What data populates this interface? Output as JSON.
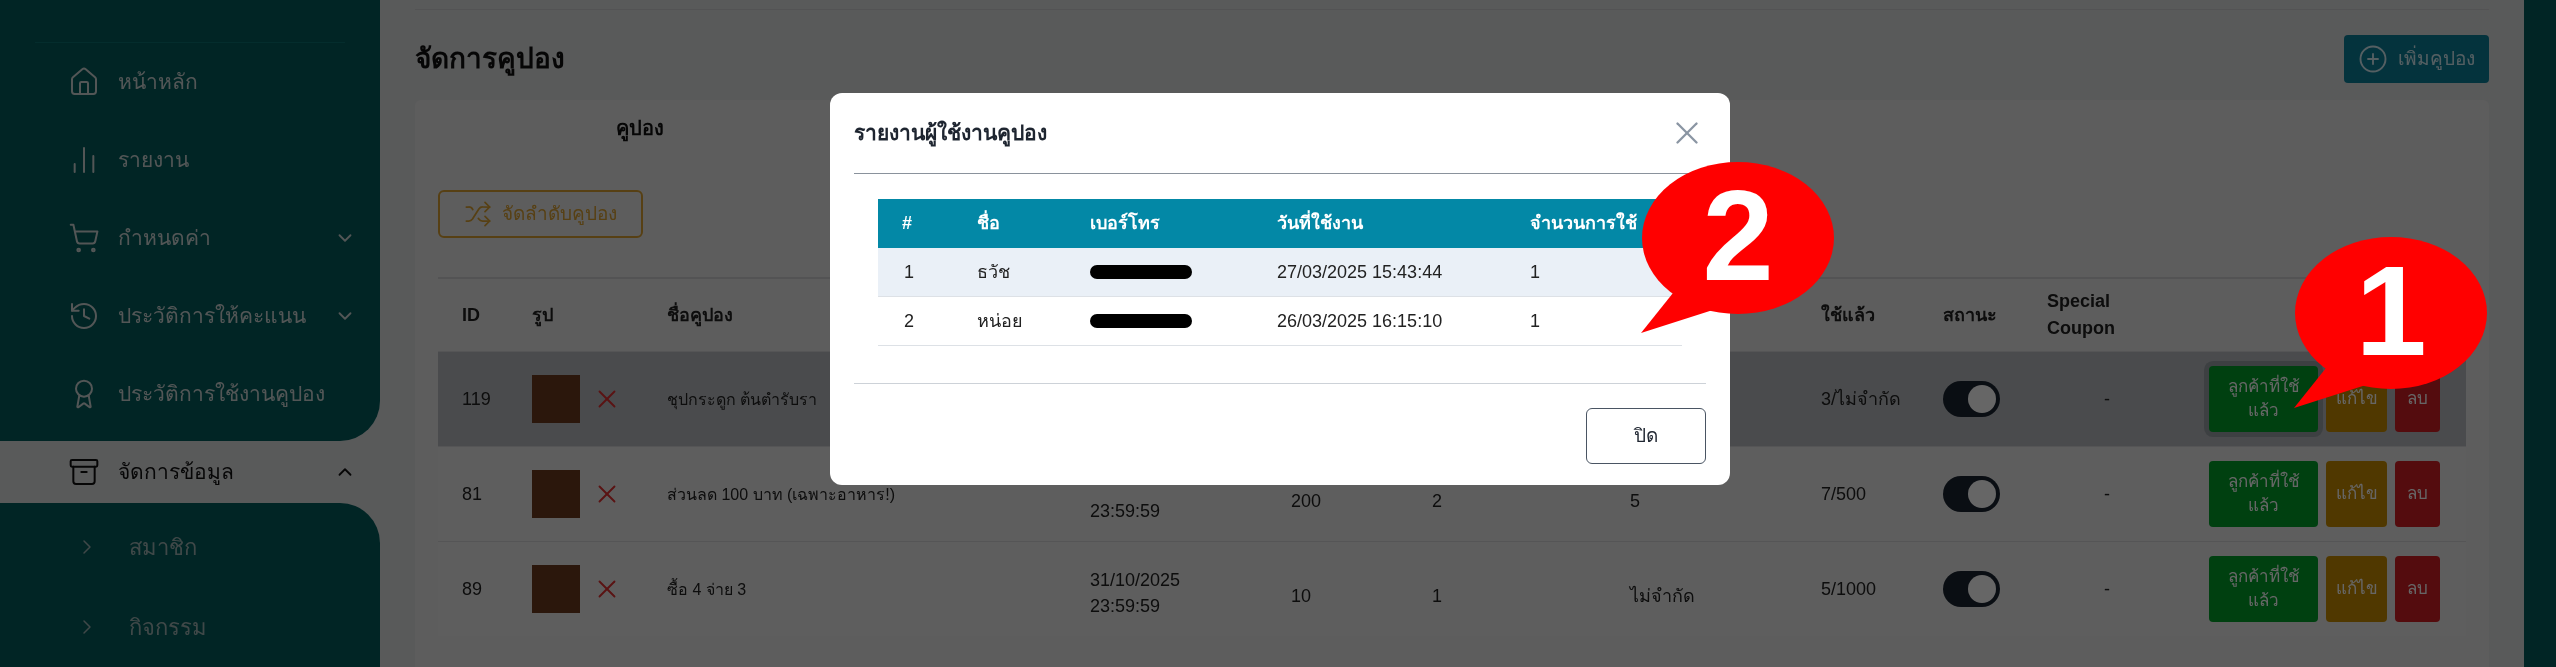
{
  "sidebar": {
    "items": [
      {
        "label": "หน้าหลัก",
        "selected": false
      },
      {
        "label": "รายงาน",
        "selected": false
      },
      {
        "label": "กำหนดค่า",
        "selected": false,
        "expanded": false
      },
      {
        "label": "ประวัติการให้คะแนน",
        "selected": false,
        "expanded": false
      },
      {
        "label": "ประวัติการใช้งานคูปอง",
        "selected": false
      },
      {
        "label": "จัดการข้อมูล",
        "selected": true,
        "expanded": true,
        "children": [
          {
            "label": "สมาชิก"
          },
          {
            "label": "กิจกรรม"
          }
        ]
      }
    ]
  },
  "page": {
    "title": "จัดการคูปอง",
    "add_button": "เพิ่มคูปอง",
    "tabs": [
      {
        "label": "คูปอง",
        "selected": true
      }
    ],
    "sort_button": "จัดลำดับคูปอง"
  },
  "table": {
    "columns": [
      {
        "label": "ID"
      },
      {
        "label": "รูป"
      },
      {
        "label": "ชื่อคูปอง"
      },
      {},
      {},
      {},
      {},
      {
        "label": "ใช้แล้ว"
      },
      {
        "label": "สถานะ"
      },
      {
        "label": "Special Coupon"
      },
      {}
    ],
    "rows": [
      {
        "id": "119",
        "name": "ชุปกระดูก ต้นตำรับรา",
        "used": "3/ไม่จำกัด",
        "status_on": true,
        "special": "-",
        "highlighted": true,
        "actions": [
          {
            "kind": "customers",
            "label": "ลูกค้าที่ใช้แล้ว",
            "focused": true
          },
          {
            "kind": "edit",
            "label": "แก้ไข",
            "focused": false
          },
          {
            "kind": "delete",
            "label": "ลบ",
            "focused": false
          }
        ]
      },
      {
        "id": "81",
        "name": "ส่วนลด 100 บาท (เฉพาะอาหาร!)",
        "date_lines": [
          "23:59:59"
        ],
        "column_5": "200",
        "column_6": "2",
        "column_7": "5",
        "used": "7/500",
        "status_on": true,
        "special": "-",
        "highlighted": false,
        "actions": [
          {
            "kind": "customers",
            "label": "ลูกค้าที่ใช้แล้ว",
            "focused": false
          },
          {
            "kind": "edit",
            "label": "แก้ไข",
            "focused": false
          },
          {
            "kind": "delete",
            "label": "ลบ",
            "focused": false
          }
        ]
      },
      {
        "id": "89",
        "name": "ซื้อ 4 จ่าย 3",
        "date_lines": [
          "31/10/2025",
          "23:59:59"
        ],
        "column_5": "10",
        "column_6": "1",
        "column_7": "ไม่จำกัด",
        "used": "5/1000",
        "status_on": true,
        "special": "-",
        "highlighted": false,
        "actions": [
          {
            "kind": "customers",
            "label": "ลูกค้าที่ใช้แล้ว",
            "focused": false
          },
          {
            "kind": "edit",
            "label": "แก้ไข",
            "focused": false
          },
          {
            "kind": "delete",
            "label": "ลบ",
            "focused": false
          }
        ]
      }
    ]
  },
  "modal": {
    "title": "รายงานผู้ใช้งานคูปอง",
    "columns": [
      "#",
      "ชื่อ",
      "เบอร์โทร",
      "วันที่ใช้งาน",
      "จำนวนการใช้"
    ],
    "rows": [
      {
        "index": "1",
        "name": "ธวัช",
        "phone_redacted": true,
        "date": "27/03/2025 15:43:44",
        "count": "1",
        "striped": true
      },
      {
        "index": "2",
        "name": "หน่อย",
        "phone_redacted": true,
        "date": "26/03/2025 16:15:10",
        "count": "1",
        "striped": false
      }
    ],
    "close_button": "ปิด"
  },
  "annotations": [
    {
      "label": "1"
    },
    {
      "label": "2"
    }
  ]
}
